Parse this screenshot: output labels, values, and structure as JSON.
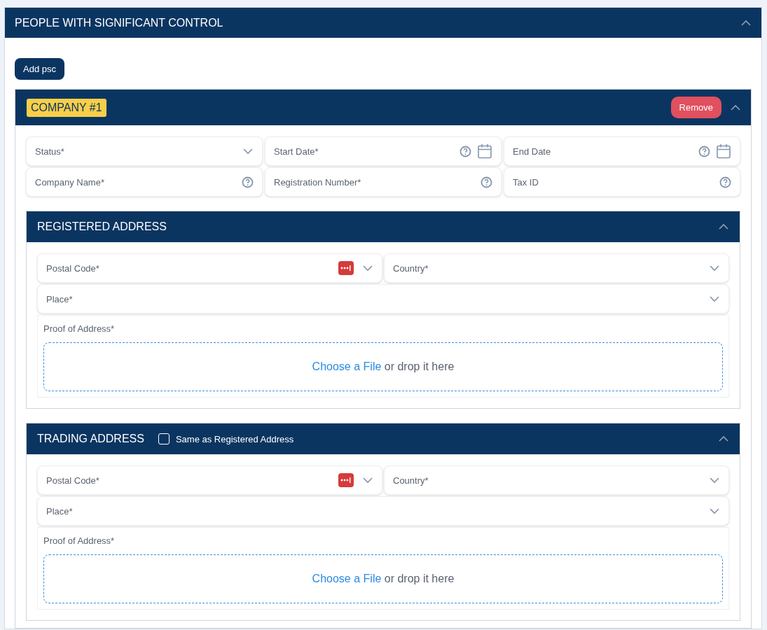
{
  "panel": {
    "title": "PEOPLE WITH SIGNIFICANT CONTROL",
    "expanded": true
  },
  "add_button": "Add psc",
  "company": {
    "badge": "COMPANY #1",
    "remove_button": "Remove",
    "expanded": true,
    "fields": [
      {
        "kind": "select",
        "placeholder": "Status*"
      },
      {
        "kind": "date",
        "placeholder": "Start Date*"
      },
      {
        "kind": "date",
        "placeholder": "End Date"
      },
      {
        "kind": "text",
        "placeholder": "Company Name*"
      },
      {
        "kind": "text",
        "placeholder": "Registration Number*"
      },
      {
        "kind": "text",
        "placeholder": "Tax ID"
      }
    ]
  },
  "addresses": [
    {
      "title": "REGISTERED ADDRESS",
      "expanded": true,
      "rows": [
        [
          {
            "kind": "postal",
            "placeholder": "Postal Code*"
          },
          {
            "kind": "select",
            "placeholder": "Country*"
          }
        ],
        [
          {
            "kind": "select",
            "placeholder": "Place*"
          }
        ]
      ],
      "proof": {
        "label": "Proof of Address*",
        "link": "Choose a File",
        "text": "or drop it here"
      }
    },
    {
      "title": "TRADING ADDRESS",
      "same_as": {
        "label": "Same as Registered Address",
        "checked": false
      },
      "expanded": true,
      "rows": [
        [
          {
            "kind": "postal",
            "placeholder": "Postal Code*"
          },
          {
            "kind": "select",
            "placeholder": "Country*"
          }
        ],
        [
          {
            "kind": "select",
            "placeholder": "Place*"
          }
        ]
      ],
      "proof": {
        "label": "Proof of Address*",
        "link": "Choose a File",
        "text": "or drop it here"
      }
    }
  ]
}
